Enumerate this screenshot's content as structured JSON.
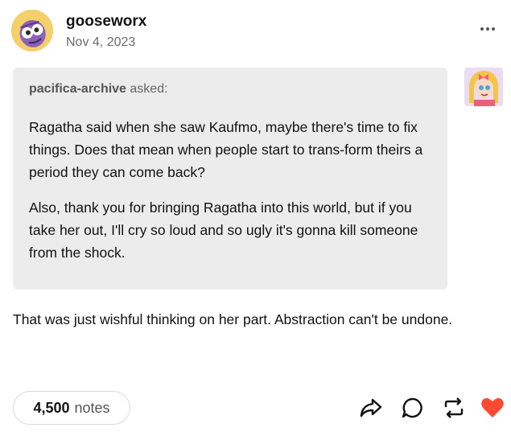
{
  "post": {
    "author": "gooseworx",
    "date": "Nov 4, 2023"
  },
  "ask": {
    "asker": "pacifica-archive",
    "asked_word": "asked:",
    "paragraphs": [
      "Ragatha said when she saw Kaufmo, maybe there's time to fix things. Does that mean when people start to trans-form theirs a period they can come back?",
      "Also, thank you for bringing Ragatha into this world, but if you take her out, I'll cry so loud and so ugly it's gonna kill someone from the shock."
    ]
  },
  "answer": {
    "text": "That was just wishful thinking on her part. Abstraction can't be undone."
  },
  "footer": {
    "notes_count": "4,500",
    "notes_label": "notes"
  },
  "icons": {
    "more": "more-dots-icon",
    "share": "share-icon",
    "reply": "reply-icon",
    "reblog": "reblog-icon",
    "like": "heart-icon"
  },
  "colors": {
    "like": "#ff4930",
    "ask_bg": "#ececec",
    "secondary_text": "#6b6b6b"
  }
}
